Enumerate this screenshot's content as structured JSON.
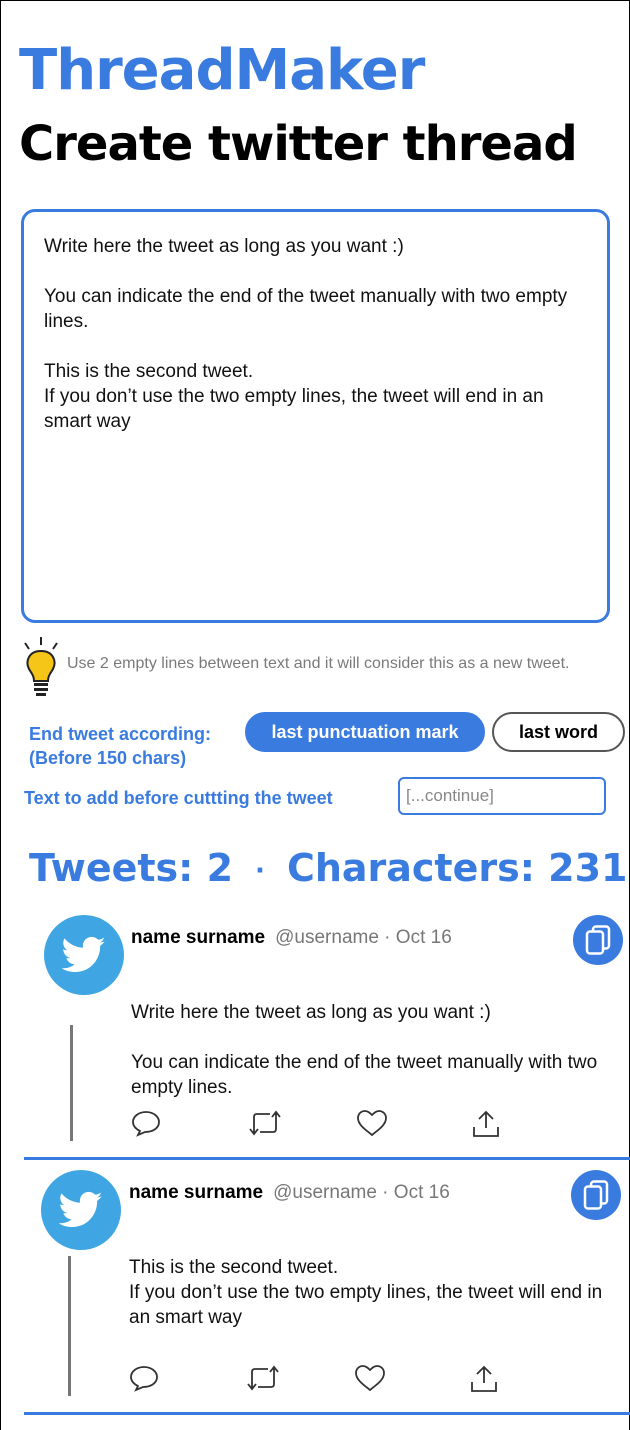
{
  "app": {
    "title": "ThreadMaker"
  },
  "page": {
    "title": "Create twitter thread"
  },
  "editor": {
    "value": "Write here the tweet as long as you want :)\n\nYou can indicate the end of the tweet manually with two empty lines.\n\nThis is the second tweet.\nIf you don’t use the two empty lines, the tweet will end in an smart way"
  },
  "hint": {
    "icon": "lightbulb-icon",
    "icon_color": "#f5c518",
    "text": "Use 2 empty lines between text and it will consider this as a new tweet."
  },
  "end_tweet": {
    "label": "End tweet according:\n(Before 150 chars)",
    "options": [
      {
        "label": "last punctuation mark",
        "selected": true
      },
      {
        "label": "last word",
        "selected": false
      }
    ]
  },
  "prefix": {
    "label": "Text to add before cuttting the tweet",
    "placeholder": "[...continue]"
  },
  "stats": {
    "tweets_label": "Tweets: 2",
    "separator": "·",
    "characters_label": "Characters: 231"
  },
  "tweets": [
    {
      "name": "name surname",
      "handle": "@username · Oct 16",
      "text": "Write here the tweet as long as you want :)\n\nYou can indicate the end of the tweet manually with two empty lines."
    },
    {
      "name": "name surname",
      "handle": "@username · Oct 16",
      "text": "This is the second tweet.\nIf you don’t use the two empty lines, the tweet will end in an smart way"
    }
  ],
  "colors": {
    "accent": "#3a7be0",
    "avatar": "#3fa6e3",
    "muted_text": "#777777"
  },
  "icons": {
    "avatar": "twitter-bird-icon",
    "copy": "copy-icon",
    "reply": "comment-icon",
    "retweet": "retweet-icon",
    "like": "heart-icon",
    "share": "share-icon"
  }
}
